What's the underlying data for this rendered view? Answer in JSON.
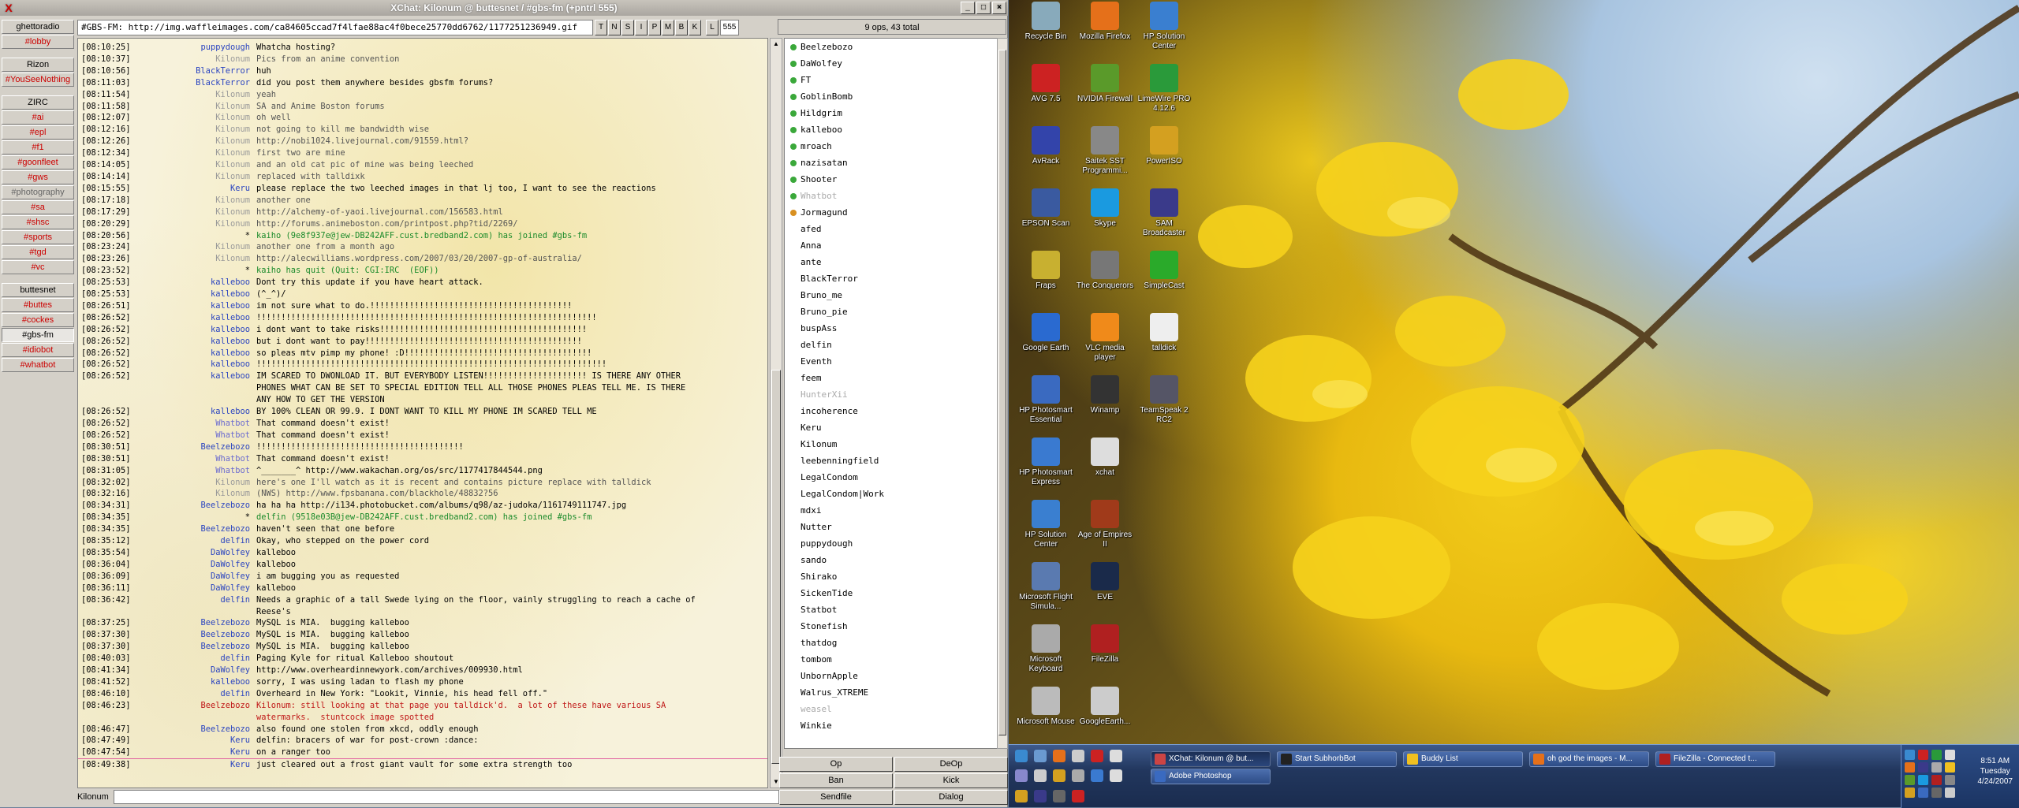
{
  "window": {
    "title": "XChat: Kilonum @ buttesnet / #gbs-fm (+pntrl 555)",
    "icon": "X"
  },
  "tree": [
    {
      "t": "srv",
      "label": "ghettoradio"
    },
    {
      "t": "chn",
      "label": "#lobby"
    },
    {
      "t": "gap"
    },
    {
      "t": "srv",
      "label": "Rizon"
    },
    {
      "t": "chn",
      "label": "#YouSeeNothing"
    },
    {
      "t": "gap"
    },
    {
      "t": "srv",
      "label": "ZIRC",
      "gray": true
    },
    {
      "t": "chn",
      "label": "#ai"
    },
    {
      "t": "chn",
      "label": "#epl"
    },
    {
      "t": "chn",
      "label": "#f1"
    },
    {
      "t": "chn",
      "label": "#goonfleet"
    },
    {
      "t": "chn",
      "label": "#gws"
    },
    {
      "t": "chn",
      "label": "#photography",
      "gray": true
    },
    {
      "t": "chn",
      "label": "#sa"
    },
    {
      "t": "chn",
      "label": "#shsc"
    },
    {
      "t": "chn",
      "label": "#sports"
    },
    {
      "t": "chn",
      "label": "#tgd"
    },
    {
      "t": "chn",
      "label": "#vc"
    },
    {
      "t": "gap"
    },
    {
      "t": "srv",
      "label": "buttesnet"
    },
    {
      "t": "chn",
      "label": "#buttes"
    },
    {
      "t": "chn",
      "label": "#cockes"
    },
    {
      "t": "chn",
      "label": "#gbs-fm",
      "active": true
    },
    {
      "t": "chn",
      "label": "#idiobot"
    },
    {
      "t": "chn",
      "label": "#whatbot"
    }
  ],
  "topic": "#GBS-FM: http://img.waffleimages.com/ca84605ccad7f4lfae88ac4f0bece25770dd6762/1177251236949.gif",
  "modes": [
    "T",
    "N",
    "S",
    "I",
    "P",
    "M",
    "B",
    "K"
  ],
  "limit_label": "L",
  "limit_value": "555",
  "user_count": "9 ops, 43 total",
  "chat": [
    [
      "[08:10:25]",
      "puppydough",
      "Whatcha hosting?"
    ],
    [
      "[08:10:37]",
      "Kilonum",
      "Pics from an anime convention"
    ],
    [
      "[08:10:56]",
      "BlackTerror",
      "huh"
    ],
    [
      "[08:11:03]",
      "BlackTerror",
      "did you post them anywhere besides gbsfm forums?"
    ],
    [
      "[08:11:54]",
      "Kilonum",
      "yeah"
    ],
    [
      "[08:11:58]",
      "Kilonum",
      "SA and Anime Boston forums"
    ],
    [
      "[08:12:07]",
      "Kilonum",
      "oh well"
    ],
    [
      "[08:12:16]",
      "Kilonum",
      "not going to kill me bandwidth wise"
    ],
    [
      "[08:12:26]",
      "Kilonum",
      "http://nobi1024.livejournal.com/91559.html?"
    ],
    [
      "[08:12:34]",
      "Kilonum",
      "first two are mine"
    ],
    [
      "[08:14:05]",
      "Kilonum",
      "and an old cat pic of mine was being leeched"
    ],
    [
      "[08:14:14]",
      "Kilonum",
      "replaced with talldixk"
    ],
    [
      "[08:15:55]",
      "Keru",
      "please replace the two leeched images in that lj too, I want to see the reactions"
    ],
    [
      "[08:17:18]",
      "Kilonum",
      "another one"
    ],
    [
      "[08:17:29]",
      "Kilonum",
      "http://alchemy-of-yaoi.livejournal.com/156583.html"
    ],
    [
      "[08:20:29]",
      "Kilonum",
      "http://forums.animeboston.com/printpost.php?tid/2269/"
    ],
    [
      "[08:20:56]",
      "*",
      "kaiho (9e8f937e@jew-DB242AFF.cust.bredband2.com) has joined #gbs-fm"
    ],
    [
      "[08:23:24]",
      "Kilonum",
      "another one from a month ago"
    ],
    [
      "[08:23:26]",
      "Kilonum",
      "http://alecwilliams.wordpress.com/2007/03/20/2007-gp-of-australia/"
    ],
    [
      "[08:23:52]",
      "*",
      "kaiho has quit (Quit: CGI:IRC  (EOF))"
    ],
    [
      "[08:25:53]",
      "kalleboo",
      "Dont try this update if you have heart attack."
    ],
    [
      "[08:25:53]",
      "kalleboo",
      "(^_^)/"
    ],
    [
      "[08:26:51]",
      "kalleboo",
      "im not sure what to do.!!!!!!!!!!!!!!!!!!!!!!!!!!!!!!!!!!!!!!!!!"
    ],
    [
      "[08:26:52]",
      "kalleboo",
      "!!!!!!!!!!!!!!!!!!!!!!!!!!!!!!!!!!!!!!!!!!!!!!!!!!!!!!!!!!!!!!!!!!!!!"
    ],
    [
      "[08:26:52]",
      "kalleboo",
      "i dont want to take risks!!!!!!!!!!!!!!!!!!!!!!!!!!!!!!!!!!!!!!!!!!"
    ],
    [
      "[08:26:52]",
      "kalleboo",
      "but i dont want to pay!!!!!!!!!!!!!!!!!!!!!!!!!!!!!!!!!!!!!!!!!!!!"
    ],
    [
      "[08:26:52]",
      "kalleboo",
      "so pleas mtv pimp my phone! :D!!!!!!!!!!!!!!!!!!!!!!!!!!!!!!!!!!!!!!"
    ],
    [
      "[08:26:52]",
      "kalleboo",
      "!!!!!!!!!!!!!!!!!!!!!!!!!!!!!!!!!!!!!!!!!!!!!!!!!!!!!!!!!!!!!!!!!!!!!!!"
    ],
    [
      "[08:26:52]",
      "kalleboo",
      "IM SCARED TO DWONLOAD IT. BUT EVERYBODY LISTEN!!!!!!!!!!!!!!!!!!!!! IS THERE ANY OTHER"
    ],
    [
      "",
      "",
      "PHONES WHAT CAN BE SET TO SPECIAL EDITION TELL ALL THOSE PHONES PLEAS TELL ME. IS THERE"
    ],
    [
      "",
      "",
      "ANY HOW TO GET THE VERSION"
    ],
    [
      "[08:26:52]",
      "kalleboo",
      "BY 100% CLEAN OR 99.9. I DONT WANT TO KILL MY PHONE IM SCARED TELL ME"
    ],
    [
      "[08:26:52]",
      "Whatbot",
      "That command doesn't exist!"
    ],
    [
      "[08:26:52]",
      "Whatbot",
      "That command doesn't exist!"
    ],
    [
      "[08:30:51]",
      "Beelzebozo",
      "!!!!!!!!!!!!!!!!!!!!!!!!!!!!!!!!!!!!!!!!!!"
    ],
    [
      "[08:30:51]",
      "Whatbot",
      "That command doesn't exist!"
    ],
    [
      "[08:31:05]",
      "Whatbot",
      "^_______^ http://www.wakachan.org/os/src/1177417844544.png"
    ],
    [
      "[08:32:02]",
      "Kilonum",
      "here's one I'll watch as it is recent and contains picture replace with talldick"
    ],
    [
      "[08:32:16]",
      "Kilonum",
      "(NWS) http://www.fpsbanana.com/blackhole/48832?56"
    ],
    [
      "[08:34:31]",
      "Beelzebozo",
      "ha ha ha http://i134.photobucket.com/albums/q98/az-judoka/1161749111747.jpg"
    ],
    [
      "[08:34:35]",
      "*",
      "delfin (9518e03B@jew-DB242AFF.cust.bredband2.com) has joined #gbs-fm"
    ],
    [
      "[08:34:35]",
      "Beelzebozo",
      "haven't seen that one before"
    ],
    [
      "[08:35:12]",
      "delfin",
      "Okay, who stepped on the power cord"
    ],
    [
      "[08:35:54]",
      "DaWolfey",
      "kalleboo"
    ],
    [
      "[08:36:04]",
      "DaWolfey",
      "kalleboo"
    ],
    [
      "[08:36:09]",
      "DaWolfey",
      "i am bugging you as requested"
    ],
    [
      "[08:36:11]",
      "DaWolfey",
      "kalleboo"
    ],
    [
      "[08:36:42]",
      "delfin",
      "Needs a graphic of a tall Swede lying on the floor, vainly struggling to reach a cache of"
    ],
    [
      "",
      "",
      "Reese's"
    ],
    [
      "[08:37:25]",
      "Beelzebozo",
      "MySQL is MIA.  bugging kalleboo"
    ],
    [
      "[08:37:30]",
      "Beelzebozo",
      "MySQL is MIA.  bugging kalleboo"
    ],
    [
      "[08:37:30]",
      "Beelzebozo",
      "MySQL is MIA.  bugging kalleboo"
    ],
    [
      "[08:40:03]",
      "delfin",
      "Paging Kyle for ritual Kalleboo shoutout"
    ],
    [
      "[08:41:34]",
      "DaWolfey",
      "http://www.overheardinnewyork.com/archives/009930.html"
    ],
    [
      "[08:41:52]",
      "kalleboo",
      "sorry, I was using ladan to flash my phone"
    ],
    [
      "[08:46:10]",
      "delfin",
      "Overheard in New York: \"Lookit, Vinnie, his head fell off.\""
    ],
    [
      "[08:46:23]",
      "Beelzebozo",
      "Kilonum: still looking at that page you talldick'd.  a lot of these have various SA"
    ],
    [
      "",
      "",
      "watermarks.  stuntcock image spotted"
    ],
    [
      "[08:46:47]",
      "Beelzebozo",
      "also found one stolen from xkcd, oddly enough"
    ],
    [
      "[08:47:49]",
      "Keru",
      "delfin: bracers of war for post-crown :dance:"
    ],
    [
      "[08:47:54]",
      "Keru",
      "on a ranger too"
    ],
    [
      "[08:49:38]",
      "Keru",
      "just cleared out a frost giant vault for some extra strength too"
    ]
  ],
  "colors": {
    "nick": "#2a44c0",
    "gray_nick": "#9a9a9a",
    "join": "#1a8a2a",
    "highlight": "#c01818",
    "op": "#3aa83a",
    "voice": "#d89020"
  },
  "users": [
    [
      "Beelzebozo",
      "op"
    ],
    [
      "DaWolfey",
      "op"
    ],
    [
      "FT",
      "op"
    ],
    [
      "GoblinBomb",
      "op"
    ],
    [
      "Hildgrim",
      "op"
    ],
    [
      "kalleboo",
      "op"
    ],
    [
      "mroach",
      "op"
    ],
    [
      "nazisatan",
      "op"
    ],
    [
      "Shooter",
      "op"
    ],
    [
      "Whatbot",
      "op-away"
    ],
    [
      "Jormagund",
      "voice"
    ],
    [
      "afed",
      ""
    ],
    [
      "Anna",
      ""
    ],
    [
      "ante",
      ""
    ],
    [
      "BlackTerror",
      ""
    ],
    [
      "Bruno_me",
      ""
    ],
    [
      "Bruno_pie",
      ""
    ],
    [
      "buspAss",
      ""
    ],
    [
      "delfin",
      ""
    ],
    [
      "Eventh",
      ""
    ],
    [
      "feem",
      ""
    ],
    [
      "HunterXii",
      "away"
    ],
    [
      "incoherence",
      ""
    ],
    [
      "Keru",
      ""
    ],
    [
      "Kilonum",
      ""
    ],
    [
      "leebenningfield",
      ""
    ],
    [
      "LegalCondom",
      ""
    ],
    [
      "LegalCondom|Work",
      ""
    ],
    [
      "mdxi",
      ""
    ],
    [
      "Nutter",
      ""
    ],
    [
      "puppydough",
      ""
    ],
    [
      "sando",
      ""
    ],
    [
      "Shirako",
      ""
    ],
    [
      "SickenTide",
      ""
    ],
    [
      "Statbot",
      ""
    ],
    [
      "Stonefish",
      ""
    ],
    [
      "thatdog",
      ""
    ],
    [
      "tombom",
      ""
    ],
    [
      "UnbornApple",
      ""
    ],
    [
      "Walrus_XTREME",
      ""
    ],
    [
      "weasel",
      "away"
    ],
    [
      "Winkie",
      ""
    ]
  ],
  "buttons": {
    "op": "Op",
    "deop": "DeOp",
    "ban": "Ban",
    "kick": "Kick",
    "sendfile": "Sendfile",
    "dialog": "Dialog"
  },
  "input": {
    "nick": "Kilonum",
    "value": ""
  },
  "desktop_icons": [
    {
      "label": "Recycle Bin",
      "c": "#8ab"
    },
    {
      "label": "Mozilla Firefox",
      "c": "#e5701a"
    },
    {
      "label": "HP Solution Center",
      "c": "#3a7fd0"
    },
    {
      "label": "AVG 7.5",
      "c": "#c22"
    },
    {
      "label": "NVIDIA Firewall",
      "c": "#5a9a2a"
    },
    {
      "label": "LimeWire PRO 4.12.6",
      "c": "#2a9a3a"
    },
    {
      "label": "AvRack",
      "c": "#3344aa"
    },
    {
      "label": "Saitek SST Programmi...",
      "c": "#888"
    },
    {
      "label": "PowerISO",
      "c": "#d4a020"
    },
    {
      "label": "EPSON Scan",
      "c": "#3a5aa0"
    },
    {
      "label": "Skype",
      "c": "#1a9ae0"
    },
    {
      "label": "SAM Broadcaster",
      "c": "#3a3a8a"
    },
    {
      "label": "Fraps",
      "c": "#c8b030"
    },
    {
      "label": "The Conquerors",
      "c": "#777"
    },
    {
      "label": "SimpleCast",
      "c": "#2aaa2a"
    },
    {
      "label": "Google Earth",
      "c": "#2a6ad0"
    },
    {
      "label": "VLC media player",
      "c": "#f08a1a"
    },
    {
      "label": "talldick",
      "c": "#eee"
    },
    {
      "label": "HP Photosmart Essential",
      "c": "#3a6ac0"
    },
    {
      "label": "Winamp",
      "c": "#333"
    },
    {
      "label": "TeamSpeak 2 RC2",
      "c": "#556"
    },
    {
      "label": "HP Photosmart Express",
      "c": "#3a7ad0"
    },
    {
      "label": "xchat",
      "c": "#ddd"
    },
    {
      "label": "HP Solution Center",
      "c": "#3a7fd0"
    },
    {
      "label": "Age of Empires II",
      "c": "#a03a1a"
    },
    {
      "label": "Microsoft Flight Simula...",
      "c": "#5a7ab0"
    },
    {
      "label": "EVE",
      "c": "#1a2a4a"
    },
    {
      "label": "Microsoft Keyboard",
      "c": "#aaa"
    },
    {
      "label": "FileZilla",
      "c": "#b02020"
    },
    {
      "label": "Microsoft Mouse",
      "c": "#bbb"
    },
    {
      "label": "GoogleEarth...",
      "c": "#ccc"
    }
  ],
  "taskbar": {
    "items": [
      {
        "label": "XChat: Kilonum @ but...",
        "active": true,
        "c": "#c44"
      },
      {
        "label": "Start SubhorbBot",
        "active": false,
        "c": "#222"
      },
      {
        "label": "Buddy List",
        "active": false,
        "c": "#f0c020"
      },
      {
        "label": "oh god the images - M...",
        "active": false,
        "c": "#e5701a"
      },
      {
        "label": "FileZilla - Connected t...",
        "active": false,
        "c": "#b02020"
      },
      {
        "label": "Adobe Photoshop",
        "active": false,
        "c": "#3a6ac0"
      }
    ],
    "time": "8:51 AM",
    "day": "Tuesday",
    "date": "4/24/2007"
  }
}
